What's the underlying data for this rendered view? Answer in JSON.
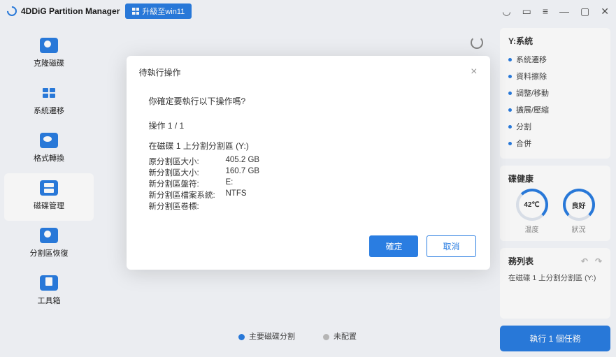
{
  "titlebar": {
    "app_name": "4DDiG Partition Manager",
    "upgrade_label": "升級至win11"
  },
  "sidebar": {
    "items": [
      {
        "label": "克隆磁碟"
      },
      {
        "label": "系統遷移"
      },
      {
        "label": "格式轉換"
      },
      {
        "label": "磁碟管理"
      },
      {
        "label": "分割區恢復"
      },
      {
        "label": "工具箱"
      }
    ]
  },
  "right": {
    "vol_title": "Y:系统",
    "ops": [
      "系統遷移",
      "資料擦除",
      "調整/移動",
      "擴展/壓縮",
      "分割",
      "合併"
    ],
    "health_title": "碟健康",
    "temp_value": "42℃",
    "state_value": "良好",
    "temp_label": "温度",
    "state_label": "狀況",
    "queue_title": "務列表",
    "queue_item": "在磁碟 1 上分割分割區  (Y:)",
    "run_label": "執行 1 個任務"
  },
  "legend": {
    "primary": "主要磁碟分割",
    "unalloc": "未配置"
  },
  "modal": {
    "title": "待執行操作",
    "confirm": "你確定要執行以下操作嗎?",
    "counter": "操作 1 / 1",
    "op_heading": "在磁碟 1 上分割分割區  (Y:)",
    "rows": {
      "orig_size_k": "原分割區大小:",
      "orig_size_v": "405.2 GB",
      "new_size_k": "新分割區大小:",
      "new_size_v": "160.7 GB",
      "letter_k": "新分割區盤符:",
      "letter_v": "E:",
      "fs_k": "新分割區檔案系統:",
      "fs_v": "NTFS",
      "label_k": "新分割區卷標:",
      "label_v": ""
    },
    "ok": "確定",
    "cancel": "取消"
  }
}
